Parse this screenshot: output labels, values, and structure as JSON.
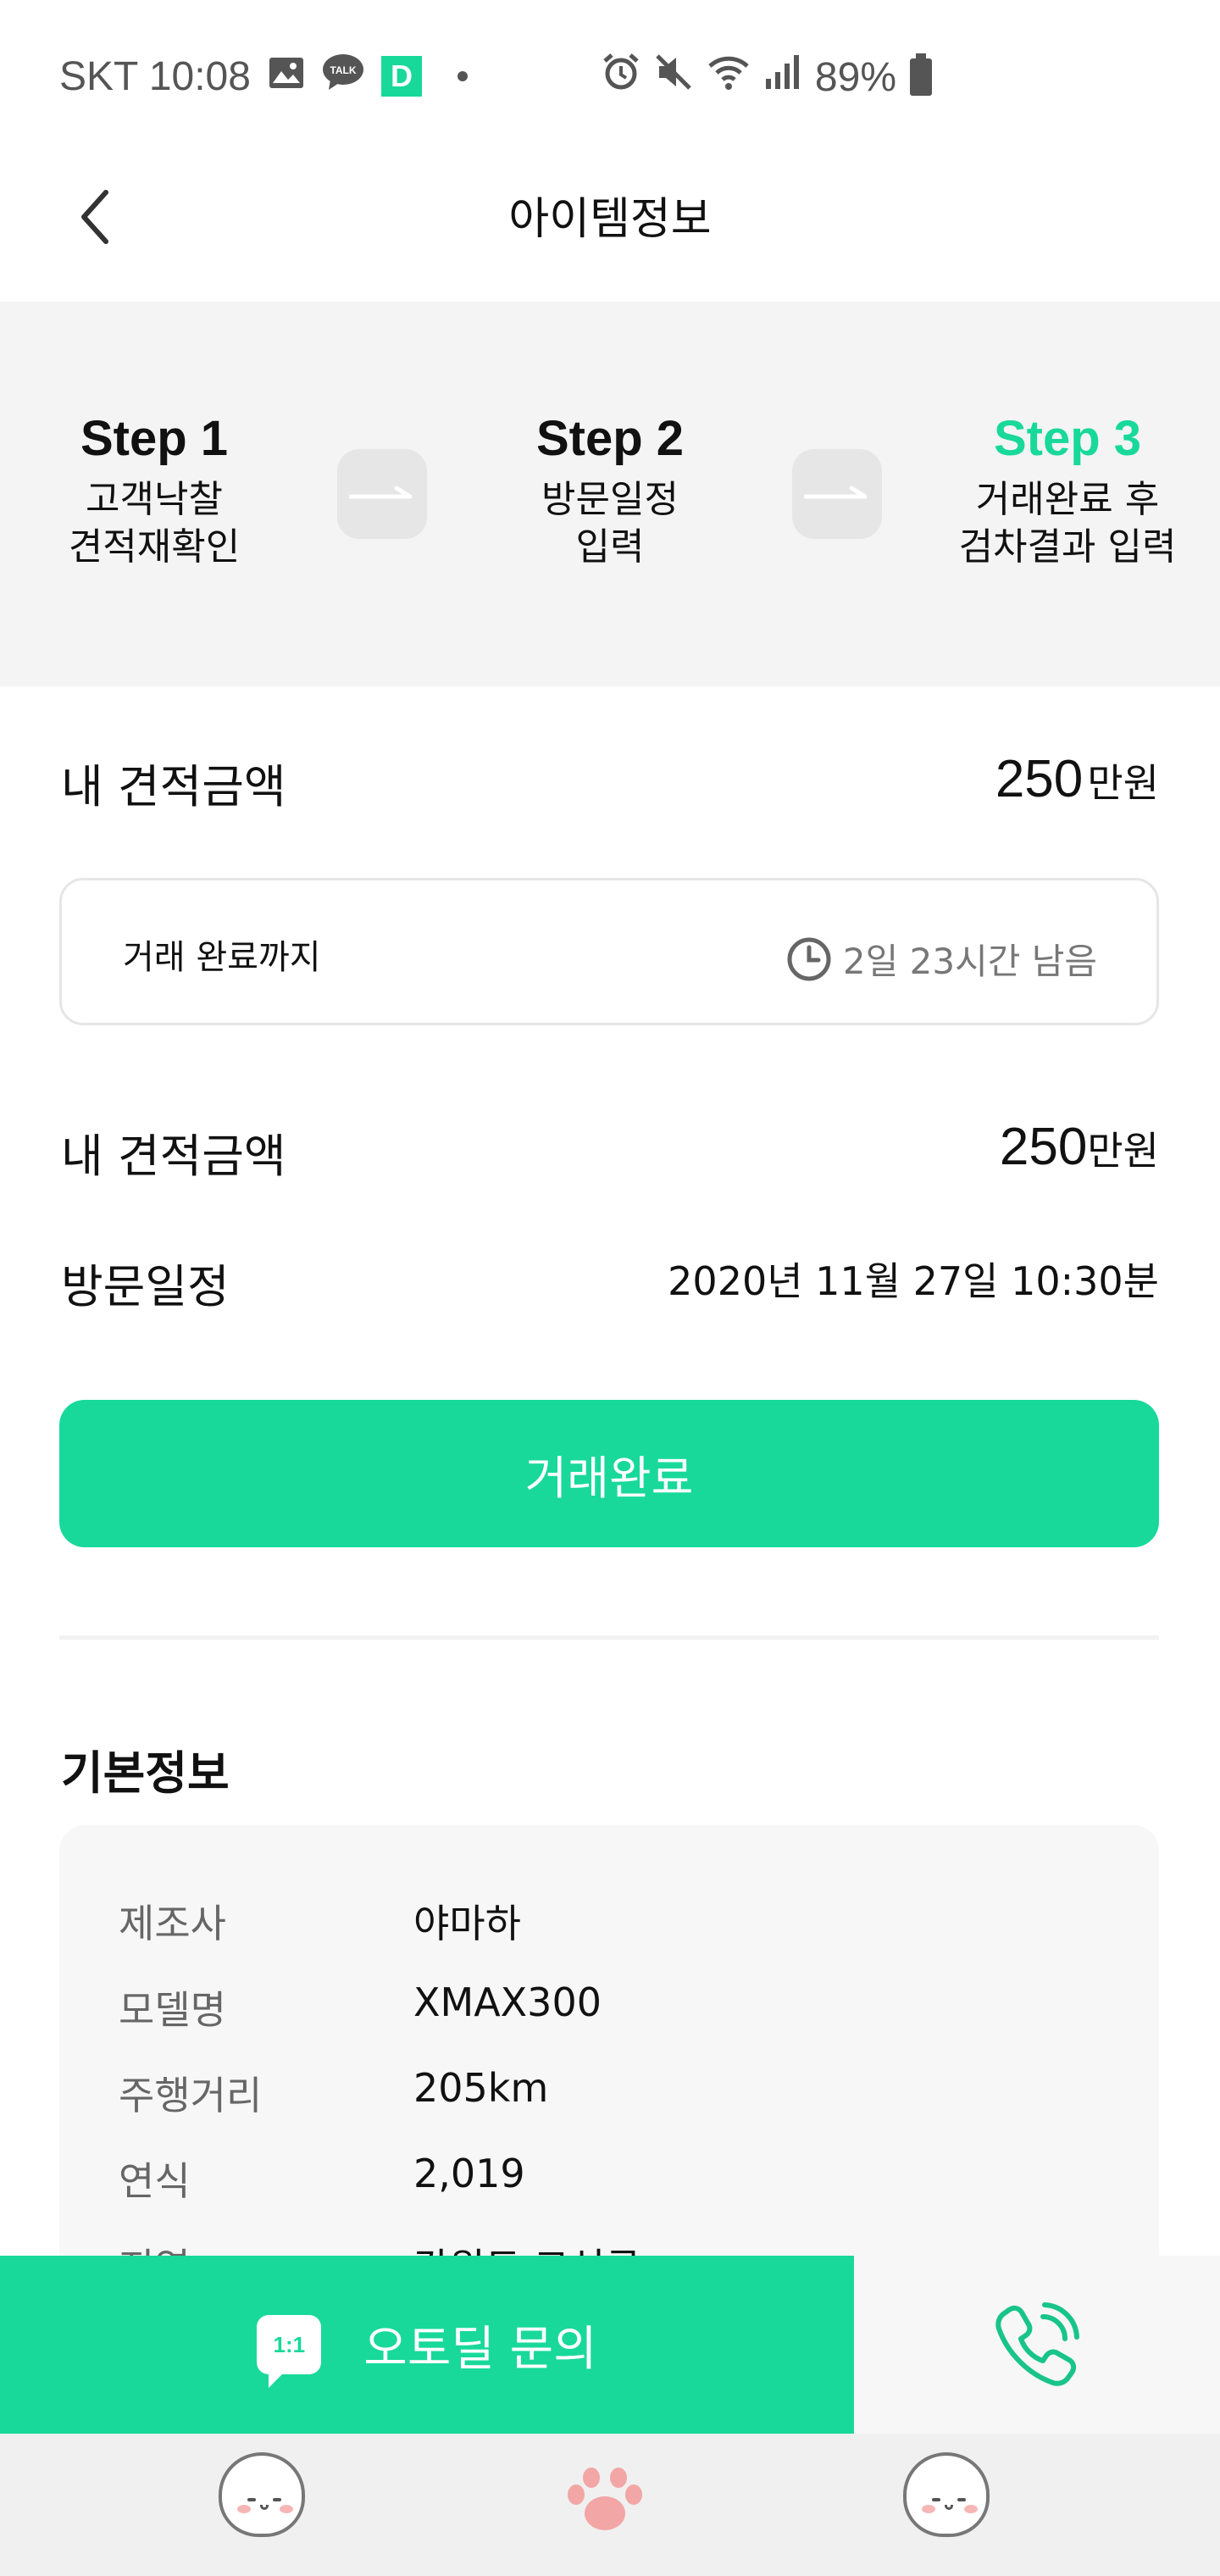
{
  "status_bar": {
    "carrier_time": "SKT 10:08",
    "battery": "89%",
    "icons": [
      "image-icon",
      "kakaotalk-icon",
      "d-app-icon",
      "alarm-icon",
      "mute-icon",
      "wifi-icon",
      "signal-icon",
      "battery-icon"
    ],
    "talk_label": "TALK",
    "d_label": "D"
  },
  "header": {
    "title": "아이템정보",
    "back_icon": "chevron-left-icon"
  },
  "steps": [
    {
      "title": "Step 1",
      "desc_line1": "고객낙찰",
      "desc_line2": "견적재확인",
      "active": false
    },
    {
      "title": "Step 2",
      "desc_line1": "방문일정",
      "desc_line2": "입력",
      "active": false
    },
    {
      "title": "Step 3",
      "desc_line1": "거래완료 후",
      "desc_line2": "검차결과 입력",
      "active": true
    }
  ],
  "quote": {
    "label": "내 견적금액",
    "amount": "250",
    "unit": "만원"
  },
  "timer": {
    "label": "거래 완료까지",
    "remaining": "2일 23시간 남음",
    "icon": "clock-icon"
  },
  "summary": {
    "quote_label": "내 견적금액",
    "quote_amount": "250",
    "quote_unit": "만원",
    "visit_label": "방문일정",
    "visit_value": "2020년 11월 27일 10:30분"
  },
  "complete_button": "거래완료",
  "basic_info": {
    "title": "기본정보",
    "rows": [
      {
        "key": "제조사",
        "value": "야마하"
      },
      {
        "key": "모델명",
        "value": "XMAX300"
      },
      {
        "key": "주행거리",
        "value": "205km"
      },
      {
        "key": "연식",
        "value": "2,019"
      },
      {
        "key": "지역",
        "value": "강원도 고성군"
      }
    ]
  },
  "bottom": {
    "inquiry_label": "오토딜 문의",
    "inquiry_badge": "1:1",
    "call_icon": "phone-icon"
  },
  "colors": {
    "accent": "#18d99a",
    "steps_bg": "#f4f4f4",
    "card_bg": "#f7f7f7"
  },
  "navbar": {
    "icons": [
      "character-face-icon",
      "paw-icon",
      "character-face-icon"
    ]
  }
}
